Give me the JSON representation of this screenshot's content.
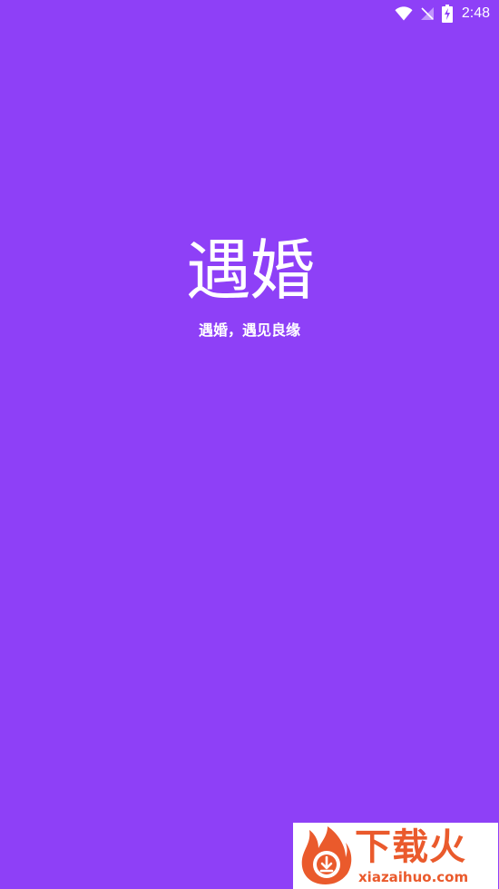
{
  "status_bar": {
    "time": "2:48",
    "icons": [
      "wifi-icon",
      "no-signal-icon",
      "battery-charging-icon"
    ]
  },
  "splash": {
    "logo_text": "遇婚",
    "slogan": "遇婚，遇见良缘"
  },
  "watermark": {
    "brand": "下载火",
    "domain": "xiazaihuo.com"
  },
  "colors": {
    "background": "#8e40f7",
    "foreground": "#ffffff",
    "watermark_accent": "#ea5a2c"
  }
}
